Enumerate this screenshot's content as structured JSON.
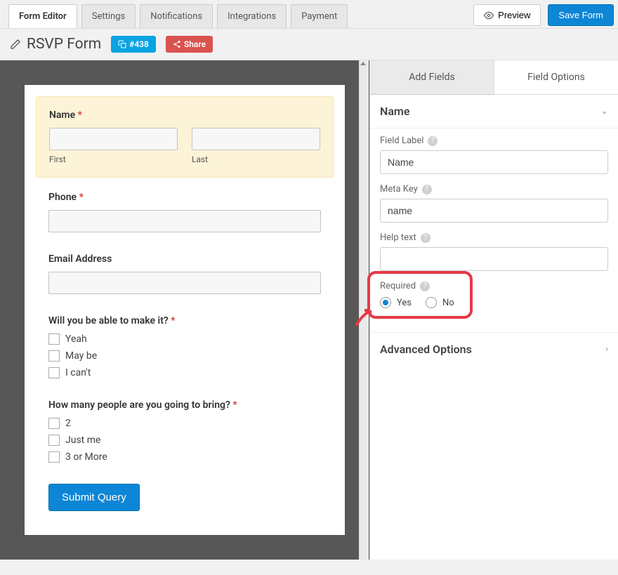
{
  "tabs": [
    "Form Editor",
    "Settings",
    "Notifications",
    "Integrations",
    "Payment"
  ],
  "actions": {
    "preview": "Preview",
    "save": "Save Form"
  },
  "form": {
    "title": "RSVP Form",
    "id_badge": "#438",
    "share": "Share"
  },
  "canvas": {
    "name_field": {
      "label": "Name",
      "sub_first": "First",
      "sub_last": "Last"
    },
    "phone": {
      "label": "Phone"
    },
    "email": {
      "label": "Email Address"
    },
    "attend": {
      "label": "Will you be able to make it?",
      "opts": [
        "Yeah",
        "May be",
        "I can't"
      ]
    },
    "count": {
      "label": "How many people are you going to bring?",
      "opts": [
        "2",
        "Just me",
        "3 or More"
      ]
    },
    "submit": "Submit Query"
  },
  "sidebar": {
    "tab_add": "Add Fields",
    "tab_opts": "Field Options",
    "section_title": "Name",
    "field_label": {
      "label": "Field Label",
      "value": "Name"
    },
    "meta_key": {
      "label": "Meta Key",
      "value": "name"
    },
    "help_text": {
      "label": "Help text",
      "value": ""
    },
    "required": {
      "label": "Required",
      "yes": "Yes",
      "no": "No"
    },
    "advanced": "Advanced Options"
  }
}
